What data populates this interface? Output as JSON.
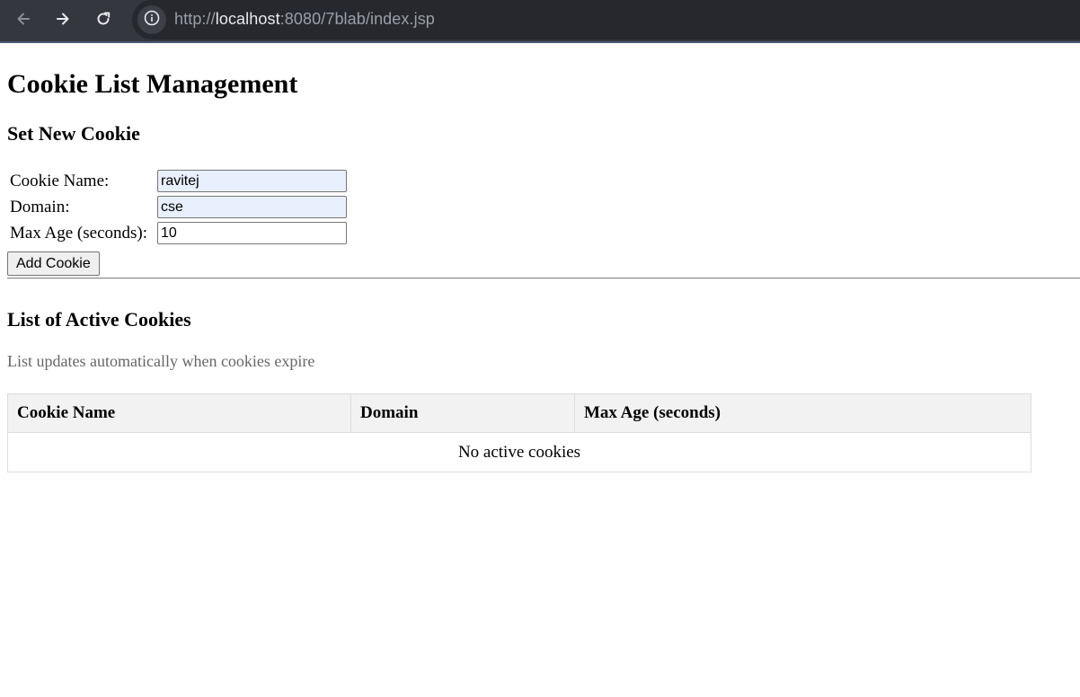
{
  "browser": {
    "url_host": "localhost",
    "url_rest": ":8080/7blab/index.jsp",
    "url_prefix": "http://",
    "icons": {
      "back": "arrow-left-icon",
      "forward": "arrow-right-icon",
      "reload": "reload-icon",
      "site_info": "info-icon"
    }
  },
  "page": {
    "title": "Cookie List Management",
    "form": {
      "heading": "Set New Cookie",
      "fields": [
        {
          "label": "Cookie Name:",
          "value": "ravitej"
        },
        {
          "label": "Domain:",
          "value": "cse"
        },
        {
          "label": "Max Age (seconds):",
          "value": "10"
        }
      ],
      "submit_label": "Add Cookie"
    },
    "list": {
      "heading": "List of Active Cookies",
      "hint": "List updates automatically when cookies expire",
      "columns": [
        "Cookie Name",
        "Domain",
        "Max Age (seconds)"
      ],
      "empty_message": "No active cookies"
    }
  },
  "colors": {
    "chrome_bg": "#35373f",
    "address_bg": "#26282e",
    "autofill_bg": "#e8f0fe",
    "table_header_bg": "#f2f2f2",
    "hint_text": "#666666"
  }
}
